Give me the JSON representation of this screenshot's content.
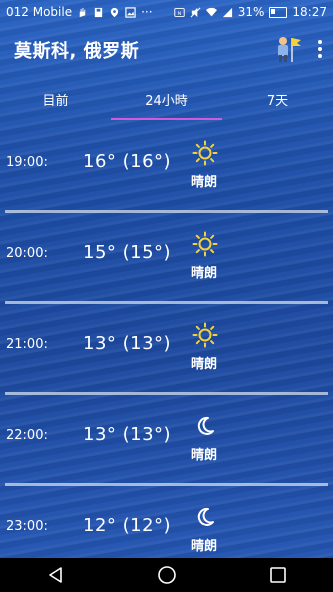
{
  "status_bar": {
    "carrier": "012 Mobile",
    "battery": "31%",
    "time": "18:27"
  },
  "app_bar": {
    "title": "莫斯科, 俄罗斯"
  },
  "tabs": [
    {
      "label": "目前",
      "active": false
    },
    {
      "label": "24小時",
      "active": true
    },
    {
      "label": "7天",
      "active": false
    }
  ],
  "forecast": [
    {
      "time": "19:00:",
      "temp": "16° (16°)",
      "icon": "sun-icon",
      "condition": "晴朗"
    },
    {
      "time": "20:00:",
      "temp": "15° (15°)",
      "icon": "sun-icon",
      "condition": "晴朗"
    },
    {
      "time": "21:00:",
      "temp": "13° (13°)",
      "icon": "sun-icon",
      "condition": "晴朗"
    },
    {
      "time": "22:00:",
      "temp": "13° (13°)",
      "icon": "moon-icon",
      "condition": "晴朗"
    },
    {
      "time": "23:00:",
      "temp": "12° (12°)",
      "icon": "moon-icon",
      "condition": "晴朗"
    }
  ],
  "colors": {
    "tab_indicator": "#d35bd6",
    "sun_yellow": "#f4d23c",
    "background": "#1f4fa8"
  }
}
